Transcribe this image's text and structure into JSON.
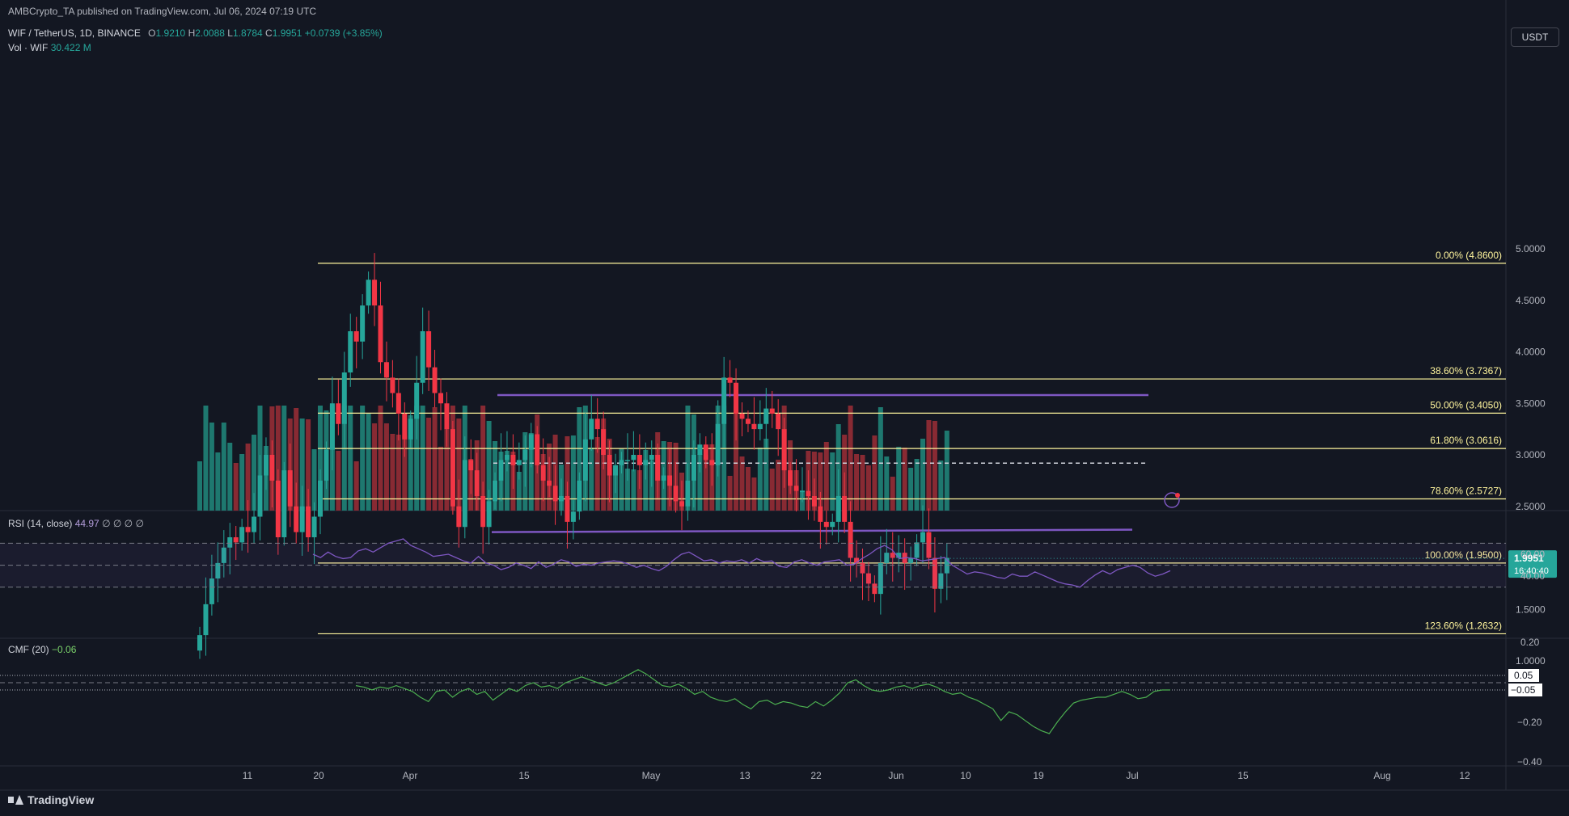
{
  "publisher_line": "AMBCrypto_TA published on TradingView.com, Jul 06, 2024 07:19 UTC",
  "symbol": {
    "name": "WIF / TetherUS, 1D, BINANCE",
    "open_label": "O",
    "open": "1.9210",
    "high_label": "H",
    "high": "2.0088",
    "low_label": "L",
    "low": "1.8784",
    "close_label": "C",
    "close": "1.9951",
    "change": "+0.0739 (+3.85%)"
  },
  "volume": {
    "label": "Vol · WIF",
    "value": "30.422 M"
  },
  "currency_button": "USDT",
  "price_tag": {
    "price": "1.9951",
    "countdown": "16:40:40"
  },
  "rsi": {
    "label": "RSI (14, close)",
    "value": "44.97",
    "extra": "∅ ∅ ∅ ∅"
  },
  "cmf": {
    "label": "CMF (20)",
    "value": "−0.06"
  },
  "branding": "TradingView",
  "colors": {
    "bg": "#131722",
    "up": "#26a69a",
    "down": "#f23645",
    "fib": "#fff59d",
    "range": "#7e57c2",
    "rsi": "#7e57c2",
    "cmf": "#4caf50"
  },
  "chart_data": {
    "type": "candlestick",
    "x_ticks": [
      "11",
      "20",
      "Apr",
      "15",
      "May",
      "13",
      "22",
      "Jun",
      "10",
      "19",
      "Jul",
      "15",
      "Aug",
      "12"
    ],
    "y_ticks": [
      "5.0000",
      "4.5000",
      "4.0000",
      "3.5000",
      "3.0000",
      "2.5000",
      "2.0000",
      "1.5000",
      "1.0000"
    ],
    "y_range": [
      0.6,
      5.0
    ],
    "fib_levels": [
      {
        "label": "0.00% (4.8600)",
        "value": 4.86
      },
      {
        "label": "38.60% (3.7367)",
        "value": 3.7367
      },
      {
        "label": "50.00% (3.4050)",
        "value": 3.405
      },
      {
        "label": "61.80% (3.0616)",
        "value": 3.0616
      },
      {
        "label": "78.60% (2.5727)",
        "value": 2.5727
      },
      {
        "label": "100.00% (1.9500)",
        "value": 1.95
      },
      {
        "label": "123.60% (1.2632)",
        "value": 1.2632
      }
    ],
    "range_high": 3.58,
    "range_mid": 2.92,
    "range_low": 2.25,
    "close": [
      1.25,
      1.55,
      1.8,
      1.95,
      2.1,
      2.2,
      2.15,
      2.3,
      2.25,
      2.4,
      2.8,
      3.0,
      2.75,
      2.2,
      2.85,
      2.5,
      2.25,
      2.5,
      2.2,
      2.4,
      2.75,
      3.05,
      3.5,
      3.3,
      3.8,
      4.2,
      4.1,
      4.45,
      4.7,
      4.45,
      3.9,
      3.75,
      3.6,
      3.4,
      3.15,
      3.35,
      3.7,
      4.2,
      3.85,
      3.6,
      3.5,
      3.25,
      2.5,
      2.3,
      2.95,
      2.85,
      2.6,
      2.3,
      2.55,
      2.75,
      2.95,
      3.0,
      2.9,
      2.95,
      3.05,
      3.2,
      2.9,
      2.75,
      2.7,
      2.55,
      2.6,
      2.35,
      2.45,
      2.75,
      3.15,
      3.35,
      3.25,
      3.0,
      2.8,
      2.9,
      2.95,
      2.95,
      3.0,
      2.9,
      2.95,
      3.0,
      2.75,
      2.8,
      2.7,
      2.55,
      2.5,
      2.75,
      3.0,
      3.1,
      2.95,
      2.9,
      3.3,
      3.75,
      3.7,
      3.4,
      3.35,
      3.3,
      3.25,
      3.3,
      3.45,
      3.4,
      3.25,
      2.85,
      2.7,
      2.65,
      2.65,
      2.6,
      2.5,
      2.35,
      2.3,
      2.35,
      2.6,
      2.35,
      2.0,
      1.95,
      1.85,
      1.75,
      1.65,
      1.95,
      2.05,
      2.0,
      2.05,
      1.95,
      2.0,
      2.15,
      2.25,
      2.0,
      1.7,
      1.85,
      2.0
    ],
    "rsi_range": [
      30,
      70
    ],
    "rsi_levels": [
      70,
      50,
      30
    ],
    "rsi": [
      60,
      57,
      62,
      58,
      56,
      57,
      63,
      65,
      62,
      66,
      70,
      72,
      74,
      68,
      65,
      62,
      58,
      59,
      60,
      57,
      54,
      52,
      58,
      52,
      50,
      46,
      48,
      52,
      50,
      47,
      53,
      48,
      51,
      55,
      53,
      49,
      51,
      50,
      52,
      53,
      54,
      53,
      51,
      48,
      50,
      47,
      45,
      49,
      55,
      60,
      62,
      58,
      54,
      55,
      52,
      54,
      53,
      55,
      52,
      56,
      53,
      54,
      49,
      48,
      53,
      55,
      52,
      50,
      53,
      54,
      55,
      50,
      51,
      56,
      60,
      65,
      68,
      64,
      56,
      57,
      56,
      54,
      55,
      56,
      57,
      50,
      46,
      42,
      44,
      43,
      41,
      39,
      38,
      42,
      40,
      40,
      44,
      41,
      38,
      35,
      33,
      32,
      30,
      36,
      41,
      45,
      42,
      46,
      48,
      50,
      48,
      43,
      40,
      42,
      45
    ],
    "cmf_range": [
      -0.4,
      0.2
    ],
    "cmf_levels": [
      0.05,
      -0.05
    ],
    "cmf": [
      -0.02,
      -0.03,
      -0.05,
      -0.03,
      -0.04,
      -0.02,
      -0.04,
      -0.06,
      -0.1,
      -0.13,
      -0.06,
      -0.05,
      -0.1,
      -0.06,
      -0.04,
      -0.08,
      -0.06,
      -0.12,
      -0.08,
      -0.04,
      -0.06,
      -0.02,
      0.0,
      -0.03,
      -0.02,
      -0.04,
      0.0,
      0.02,
      0.04,
      0.02,
      0.0,
      -0.02,
      0.0,
      0.03,
      0.06,
      0.09,
      0.06,
      0.02,
      -0.02,
      -0.03,
      -0.01,
      -0.04,
      -0.08,
      -0.06,
      -0.1,
      -0.12,
      -0.13,
      -0.11,
      -0.15,
      -0.18,
      -0.13,
      -0.12,
      -0.15,
      -0.13,
      -0.14,
      -0.16,
      -0.17,
      -0.13,
      -0.16,
      -0.12,
      -0.07,
      0.0,
      0.02,
      -0.02,
      -0.05,
      -0.06,
      -0.05,
      -0.03,
      -0.02,
      -0.04,
      -0.02,
      -0.01,
      -0.03,
      -0.06,
      -0.08,
      -0.07,
      -0.1,
      -0.12,
      -0.15,
      -0.18,
      -0.26,
      -0.2,
      -0.22,
      -0.26,
      -0.3,
      -0.33,
      -0.35,
      -0.27,
      -0.2,
      -0.14,
      -0.12,
      -0.11,
      -0.1,
      -0.1,
      -0.08,
      -0.06,
      -0.08,
      -0.11,
      -0.1,
      -0.06,
      -0.05,
      -0.05
    ],
    "cmf_value_labels": [
      "0.20",
      "−0.20",
      "−0.40"
    ],
    "cmf_tag_labels": [
      "0.05",
      "−0.05"
    ]
  }
}
